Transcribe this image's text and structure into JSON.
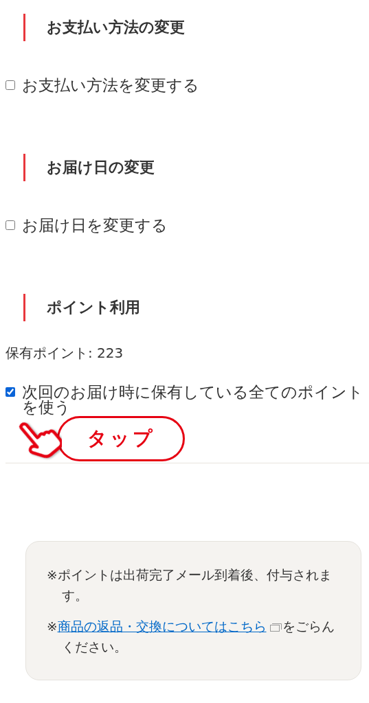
{
  "sections": [
    {
      "heading": "お支払い方法の変更",
      "options": [
        {
          "label": "お支払い方法を変更する",
          "checked": false
        }
      ]
    },
    {
      "heading": "お届け日の変更",
      "options": [
        {
          "label": "お届け日を変更する",
          "checked": false
        }
      ]
    },
    {
      "heading": "ポイント利用",
      "holdings": "保有ポイント: 223",
      "options": [
        {
          "label": "次回のお届け時に保有している全てのポイントを使う",
          "checked": true
        }
      ],
      "callout": {
        "label": "タップ"
      }
    }
  ],
  "notes": [
    {
      "kind": "text",
      "text": "※ポイントは出荷完了メール到着後、付与されます。"
    },
    {
      "kind": "link",
      "before": "※",
      "link": "商品の返品・交換についてはこちら",
      "after": "をごらんください。"
    }
  ]
}
